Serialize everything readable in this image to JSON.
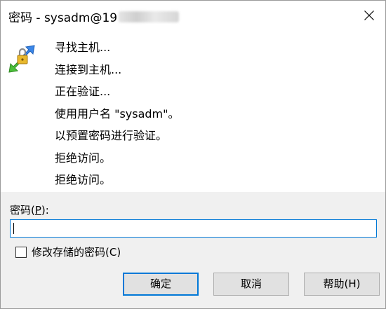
{
  "window": {
    "title_prefix": "密码 - sysadm@19",
    "title_redacted": true
  },
  "icons": {
    "app": "key-transfer-icon",
    "close": "close-icon"
  },
  "status": {
    "lines": [
      "寻找主机...",
      "连接到主机...",
      "正在验证...",
      "使用用户名 \"sysadm\"。",
      "以预置密码进行验证。",
      "拒绝访问。",
      "拒绝访问。"
    ]
  },
  "form": {
    "password_label_prefix": "密码(",
    "password_label_accel": "P",
    "password_label_suffix": "):",
    "password_value": "",
    "checkbox_label": "修改存储的密码(C)",
    "checkbox_checked": false
  },
  "buttons": {
    "ok": "确定",
    "cancel": "取消",
    "help": "帮助(H)"
  },
  "colors": {
    "accent": "#0078d7",
    "panel": "#f0f0f0",
    "button_face": "#e1e1e1"
  }
}
